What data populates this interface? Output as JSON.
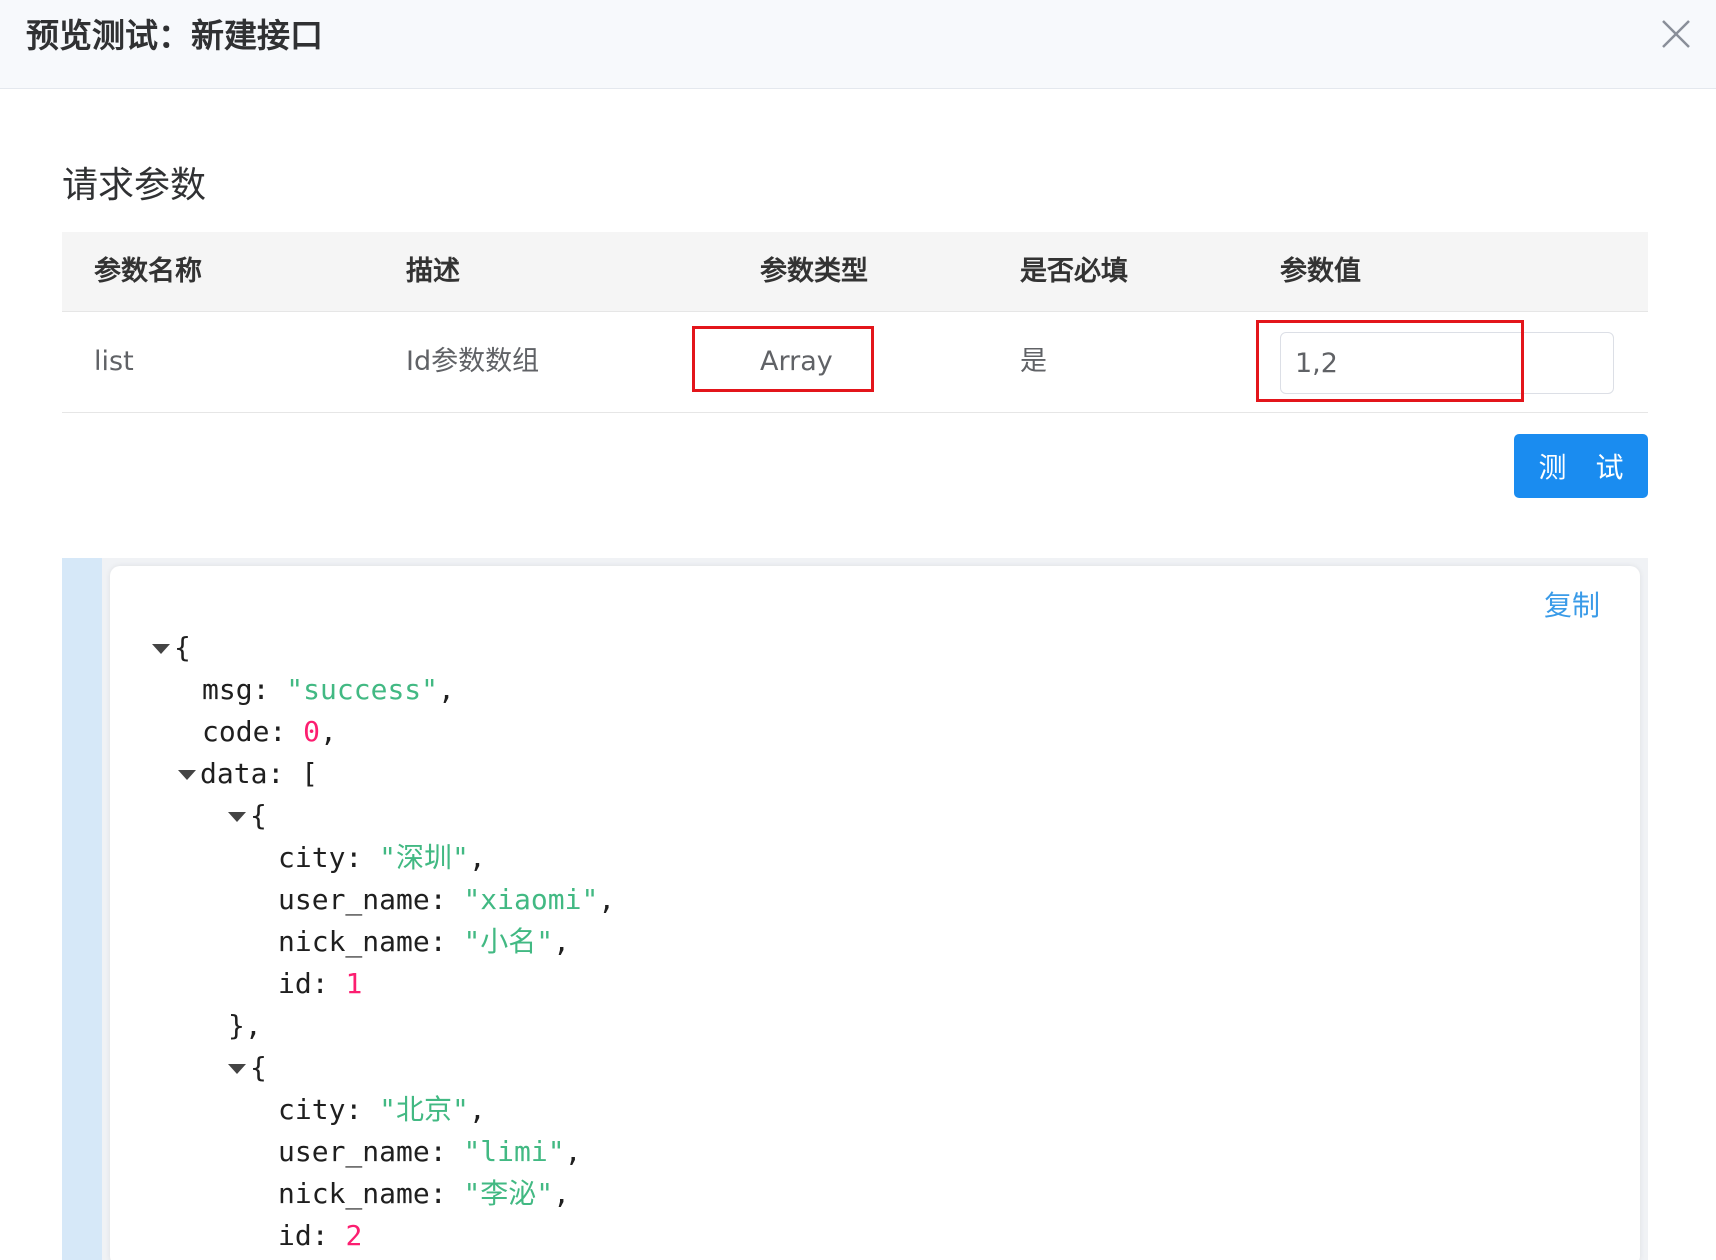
{
  "dialog": {
    "title": "预览测试：新建接口"
  },
  "request_section": {
    "title": "请求参数"
  },
  "params_table": {
    "headers": [
      "参数名称",
      "描述",
      "参数类型",
      "是否必填",
      "参数值"
    ],
    "rows": [
      {
        "name": "list",
        "description": "Id参数数组",
        "type": "Array",
        "required": "是",
        "value": "1,2"
      }
    ]
  },
  "test_button": {
    "label": "测 试"
  },
  "response": {
    "copy_label": "复制",
    "json": {
      "open_brace": "{",
      "msg_key": "msg:",
      "msg_value": "\"success\"",
      "code_key": "code:",
      "code_value": "0",
      "data_key": "data: [",
      "items": [
        {
          "open": "{",
          "city_key": "city:",
          "city_value": "\"深圳\"",
          "user_name_key": "user_name:",
          "user_name_value": "\"xiaomi\"",
          "nick_name_key": "nick_name:",
          "nick_name_value": "\"小名\"",
          "id_key": "id:",
          "id_value": "1",
          "close": "},"
        },
        {
          "open": "{",
          "city_key": "city:",
          "city_value": "\"北京\"",
          "user_name_key": "user_name:",
          "user_name_value": "\"limi\"",
          "nick_name_key": "nick_name:",
          "nick_name_value": "\"李泌\"",
          "id_key": "id:",
          "id_value": "2"
        }
      ]
    }
  },
  "colors": {
    "primary": "#1a8cf0",
    "highlight": "#e3151b",
    "json_string": "#42b983",
    "json_number": "#fc1e70"
  }
}
